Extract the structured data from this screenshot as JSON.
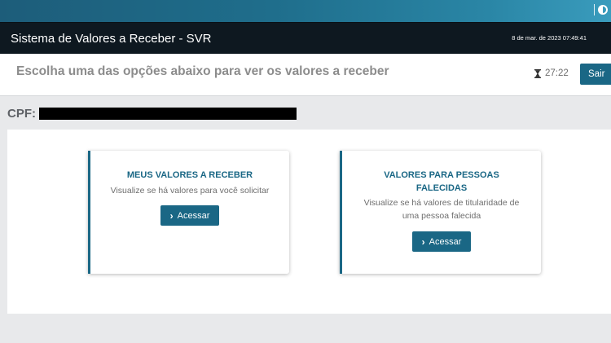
{
  "header": {
    "app_title": "Sistema de Valores a Receber - SVR",
    "datetime": "8 de mar. de 2023 07:49:41"
  },
  "subheader": {
    "instruction": "Escolha uma das opções abaixo para ver os valores a receber",
    "timer": "27:22",
    "logout_label": "Sair"
  },
  "cpf": {
    "label": "CPF:"
  },
  "cards": [
    {
      "title": "MEUS VALORES A RECEBER",
      "description": "Visualize se há valores para você solicitar",
      "button_label": "Acessar"
    },
    {
      "title": "VALORES PARA PESSOAS FALECIDAS",
      "description": "Visualize se há valores de titularidade de uma pessoa falecida",
      "button_label": "Acessar"
    }
  ],
  "colors": {
    "primary": "#1a6785",
    "header_bg": "#0e1820",
    "page_bg": "#e8e9eb"
  },
  "icons": {
    "timer": "hourglass-icon",
    "button": "chevron-right-icon",
    "accessibility": "contrast-icon"
  }
}
